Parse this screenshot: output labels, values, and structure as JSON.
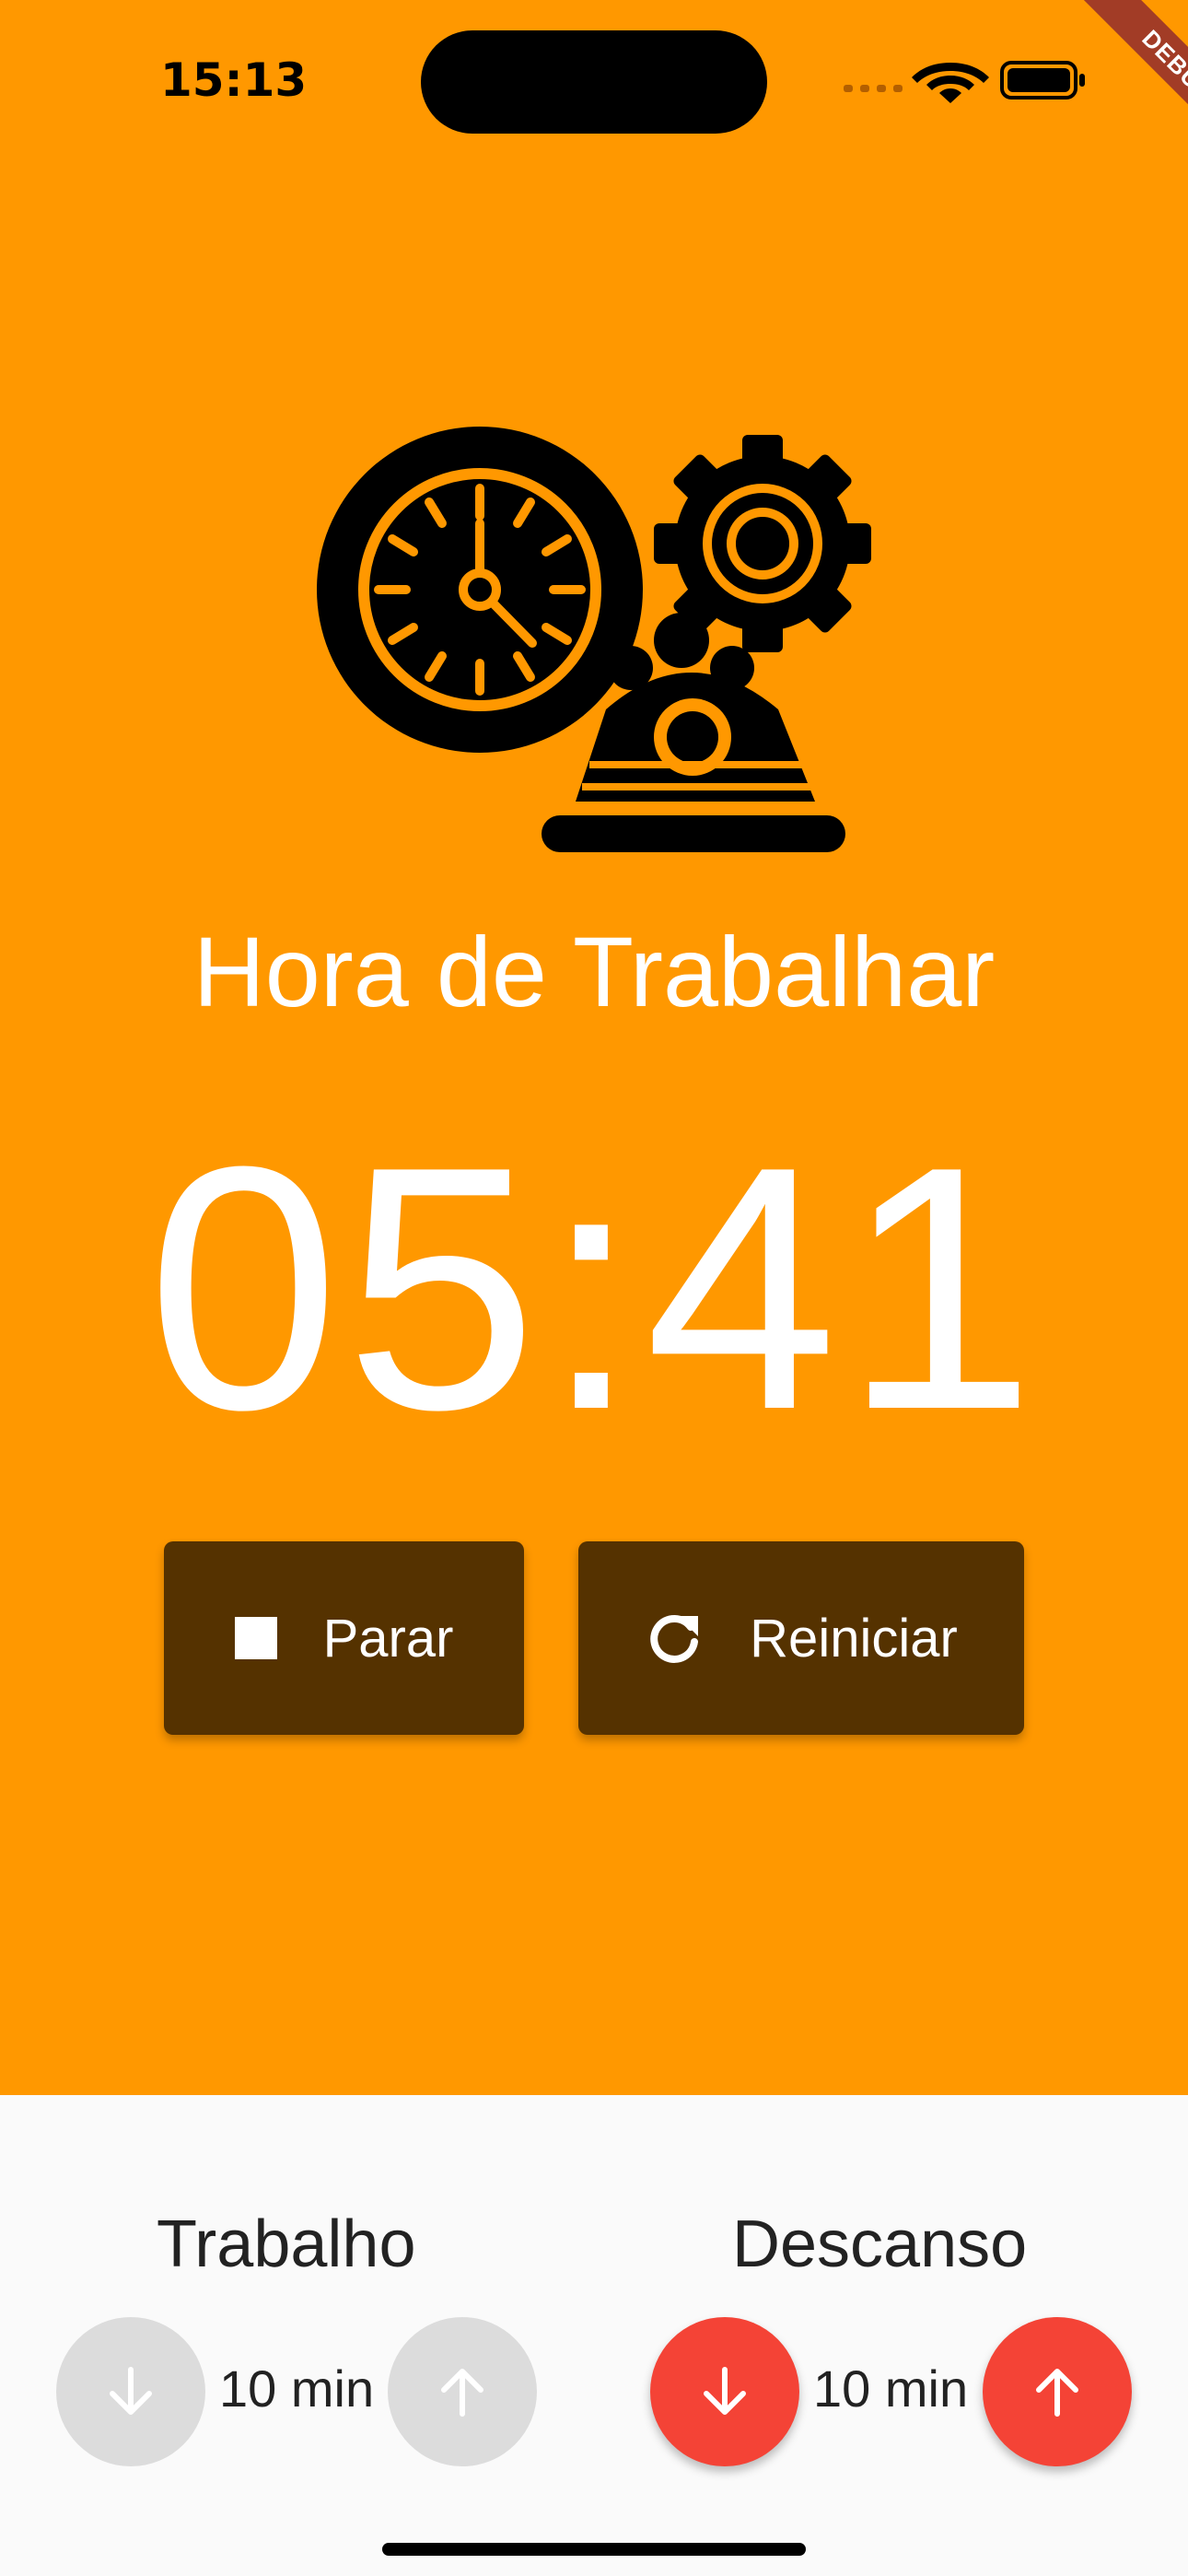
{
  "status_bar": {
    "time": "15:13",
    "debug_label": "DEBUG"
  },
  "colors": {
    "work_bg": "#ff9800",
    "button_bg": "#553200",
    "stepper_active": "#f44336",
    "stepper_disabled": "#dcdcdc"
  },
  "mode_title": "Hora de Trabalhar",
  "timer": "05:41",
  "buttons": {
    "stop_label": "Parar",
    "reset_label": "Reiniciar"
  },
  "settings": {
    "work": {
      "label": "Trabalho",
      "minutes": "10 min"
    },
    "rest": {
      "label": "Descanso",
      "minutes": "10 min"
    }
  }
}
